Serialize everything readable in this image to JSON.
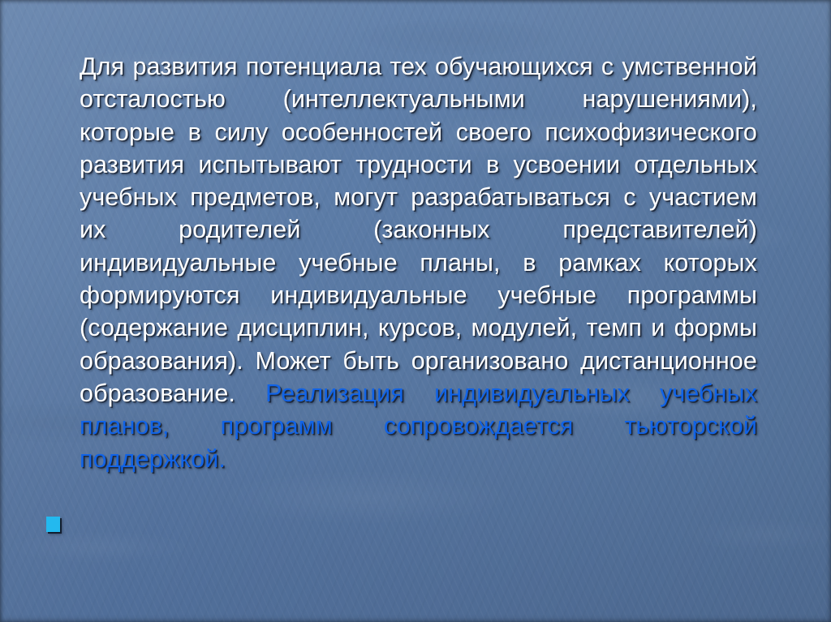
{
  "slide": {
    "background_color": "#5a7ba6",
    "background_style": "textured-steel-blue",
    "white_text_color": "#ffffff",
    "highlight_text_color": "#1163e6",
    "bullet_color": "#23b9ef"
  },
  "body": {
    "paragraph": {
      "white_run": "Для развития потенциала тех обучающихся с умственной отсталостью (интеллектуальными нарушениями), которые в силу особенностей своего психофизического развития испытывают трудности в усвоении отдельных учебных предметов, могут разрабатываться с участием их родителей (законных представителей) индивидуальные учебные планы, в рамках которых формируются индивидуальные учебные программы (содержание дисциплин, курсов, модулей, темп и формы образования). Может быть организовано дистанционное образование. ",
      "blue_run": "Реализация индивидуальных учебных планов, программ сопровождается тьюторской поддержкой."
    },
    "second_bullet": {
      "marker": "square-bullet-icon",
      "text": ""
    }
  }
}
